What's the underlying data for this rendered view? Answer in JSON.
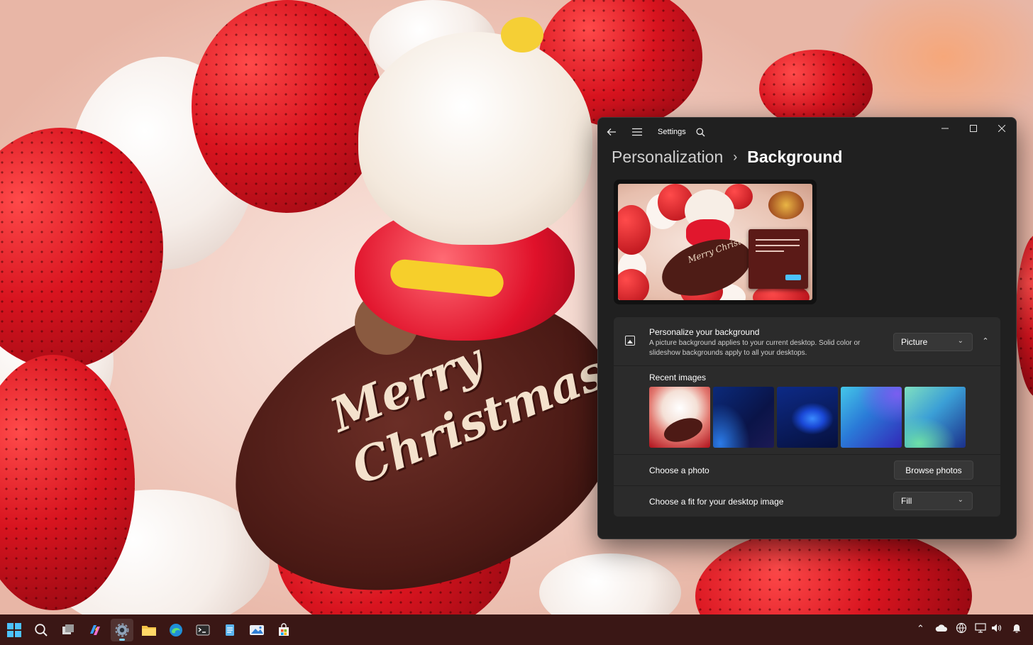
{
  "wallpaper": {
    "cake_text": "Merry Christmas"
  },
  "window": {
    "app_title": "Settings",
    "breadcrumb": {
      "parent": "Personalization",
      "separator": "›",
      "current": "Background"
    },
    "controls": {
      "minimize": "—",
      "maximize": "☐",
      "close": "✕"
    },
    "preview": {
      "text": "Merry Christmas"
    },
    "personalize": {
      "title": "Personalize your background",
      "description": "A picture background applies to your current desktop. Solid color or slideshow backgrounds apply to all your desktops.",
      "dropdown_value": "Picture",
      "dropdown_chevron": "⌄",
      "expander_glyph": "⌃"
    },
    "recent": {
      "label": "Recent images",
      "images": [
        "Christmas cake",
        "Blue waves",
        "Windows bloom",
        "Blue violet curves",
        "Green blue curves"
      ]
    },
    "choose_photo": {
      "label": "Choose a photo",
      "button": "Browse photos"
    },
    "choose_fit": {
      "label": "Choose a fit for your desktop image",
      "dropdown_value": "Fill",
      "dropdown_chevron": "⌄"
    }
  },
  "taskbar": {
    "apps": [
      "start",
      "search",
      "task-view",
      "copilot",
      "settings",
      "file-explorer",
      "edge",
      "terminal",
      "notepad",
      "photos",
      "store"
    ],
    "active_app": "settings",
    "tray_chevron": "⌃"
  },
  "colors": {
    "accent": "#4cc2ff",
    "window_bg": "#202020",
    "card_bg": "#2b2b2b",
    "taskbar_bg": "#3a1715"
  }
}
